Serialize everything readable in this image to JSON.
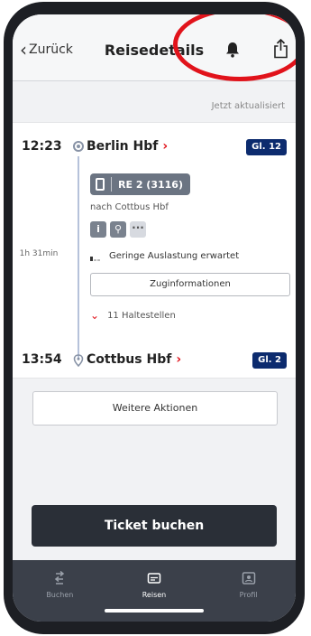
{
  "header": {
    "back_label": "Zurück",
    "title": "Reisedetails",
    "icons": [
      "chevron-left-icon",
      "bell-icon",
      "share-icon"
    ],
    "highlight_color": "#e1131b"
  },
  "updated_text": "Jetzt aktualisiert",
  "journey": {
    "departure": {
      "time": "12:23",
      "station": "Berlin Hbf",
      "arrow": "›",
      "platform": "Gl. 12"
    },
    "train": {
      "name": "RE 2 (3116)",
      "direction": "nach Cottbus Hbf"
    },
    "attributes": [
      "i",
      "⚲",
      "···"
    ],
    "duration": "1h 31min",
    "occupancy": "Geringe Auslastung erwartet",
    "train_info_button": "Zuginformationen",
    "stops": "11 Haltestellen",
    "arrival": {
      "time": "13:54",
      "station": "Cottbus Hbf",
      "arrow": "›",
      "platform": "Gl. 2"
    }
  },
  "more_actions_button": "Weitere Aktionen",
  "ticket_button": "Ticket buchen",
  "tabbar": {
    "items": [
      {
        "label": "Buchen",
        "icon": "route-icon",
        "active": false
      },
      {
        "label": "Reisen",
        "icon": "ticket-icon",
        "active": true
      },
      {
        "label": "Profil",
        "icon": "profile-icon",
        "active": false
      }
    ]
  },
  "colors": {
    "accent_red": "#e1131b",
    "platform_badge": "#0c2b6e",
    "train_badge": "#6b7482",
    "ticket_button": "#2a2f37",
    "tabbar": "#3b404a"
  }
}
